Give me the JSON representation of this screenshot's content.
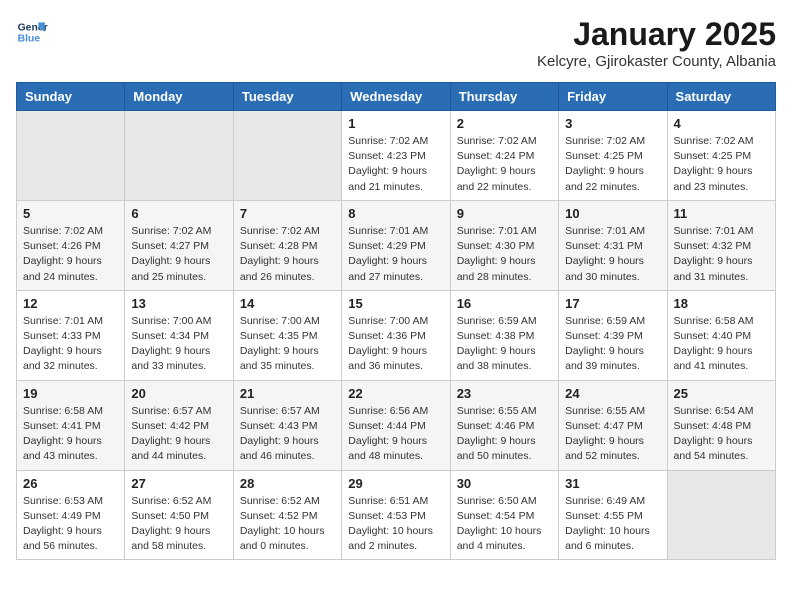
{
  "logo": {
    "line1": "General",
    "line2": "Blue"
  },
  "title": "January 2025",
  "subtitle": "Kelcyre, Gjirokaster County, Albania",
  "headers": [
    "Sunday",
    "Monday",
    "Tuesday",
    "Wednesday",
    "Thursday",
    "Friday",
    "Saturday"
  ],
  "weeks": [
    [
      {
        "day": "",
        "info": ""
      },
      {
        "day": "",
        "info": ""
      },
      {
        "day": "",
        "info": ""
      },
      {
        "day": "1",
        "info": "Sunrise: 7:02 AM\nSunset: 4:23 PM\nDaylight: 9 hours\nand 21 minutes."
      },
      {
        "day": "2",
        "info": "Sunrise: 7:02 AM\nSunset: 4:24 PM\nDaylight: 9 hours\nand 22 minutes."
      },
      {
        "day": "3",
        "info": "Sunrise: 7:02 AM\nSunset: 4:25 PM\nDaylight: 9 hours\nand 22 minutes."
      },
      {
        "day": "4",
        "info": "Sunrise: 7:02 AM\nSunset: 4:25 PM\nDaylight: 9 hours\nand 23 minutes."
      }
    ],
    [
      {
        "day": "5",
        "info": "Sunrise: 7:02 AM\nSunset: 4:26 PM\nDaylight: 9 hours\nand 24 minutes."
      },
      {
        "day": "6",
        "info": "Sunrise: 7:02 AM\nSunset: 4:27 PM\nDaylight: 9 hours\nand 25 minutes."
      },
      {
        "day": "7",
        "info": "Sunrise: 7:02 AM\nSunset: 4:28 PM\nDaylight: 9 hours\nand 26 minutes."
      },
      {
        "day": "8",
        "info": "Sunrise: 7:01 AM\nSunset: 4:29 PM\nDaylight: 9 hours\nand 27 minutes."
      },
      {
        "day": "9",
        "info": "Sunrise: 7:01 AM\nSunset: 4:30 PM\nDaylight: 9 hours\nand 28 minutes."
      },
      {
        "day": "10",
        "info": "Sunrise: 7:01 AM\nSunset: 4:31 PM\nDaylight: 9 hours\nand 30 minutes."
      },
      {
        "day": "11",
        "info": "Sunrise: 7:01 AM\nSunset: 4:32 PM\nDaylight: 9 hours\nand 31 minutes."
      }
    ],
    [
      {
        "day": "12",
        "info": "Sunrise: 7:01 AM\nSunset: 4:33 PM\nDaylight: 9 hours\nand 32 minutes."
      },
      {
        "day": "13",
        "info": "Sunrise: 7:00 AM\nSunset: 4:34 PM\nDaylight: 9 hours\nand 33 minutes."
      },
      {
        "day": "14",
        "info": "Sunrise: 7:00 AM\nSunset: 4:35 PM\nDaylight: 9 hours\nand 35 minutes."
      },
      {
        "day": "15",
        "info": "Sunrise: 7:00 AM\nSunset: 4:36 PM\nDaylight: 9 hours\nand 36 minutes."
      },
      {
        "day": "16",
        "info": "Sunrise: 6:59 AM\nSunset: 4:38 PM\nDaylight: 9 hours\nand 38 minutes."
      },
      {
        "day": "17",
        "info": "Sunrise: 6:59 AM\nSunset: 4:39 PM\nDaylight: 9 hours\nand 39 minutes."
      },
      {
        "day": "18",
        "info": "Sunrise: 6:58 AM\nSunset: 4:40 PM\nDaylight: 9 hours\nand 41 minutes."
      }
    ],
    [
      {
        "day": "19",
        "info": "Sunrise: 6:58 AM\nSunset: 4:41 PM\nDaylight: 9 hours\nand 43 minutes."
      },
      {
        "day": "20",
        "info": "Sunrise: 6:57 AM\nSunset: 4:42 PM\nDaylight: 9 hours\nand 44 minutes."
      },
      {
        "day": "21",
        "info": "Sunrise: 6:57 AM\nSunset: 4:43 PM\nDaylight: 9 hours\nand 46 minutes."
      },
      {
        "day": "22",
        "info": "Sunrise: 6:56 AM\nSunset: 4:44 PM\nDaylight: 9 hours\nand 48 minutes."
      },
      {
        "day": "23",
        "info": "Sunrise: 6:55 AM\nSunset: 4:46 PM\nDaylight: 9 hours\nand 50 minutes."
      },
      {
        "day": "24",
        "info": "Sunrise: 6:55 AM\nSunset: 4:47 PM\nDaylight: 9 hours\nand 52 minutes."
      },
      {
        "day": "25",
        "info": "Sunrise: 6:54 AM\nSunset: 4:48 PM\nDaylight: 9 hours\nand 54 minutes."
      }
    ],
    [
      {
        "day": "26",
        "info": "Sunrise: 6:53 AM\nSunset: 4:49 PM\nDaylight: 9 hours\nand 56 minutes."
      },
      {
        "day": "27",
        "info": "Sunrise: 6:52 AM\nSunset: 4:50 PM\nDaylight: 9 hours\nand 58 minutes."
      },
      {
        "day": "28",
        "info": "Sunrise: 6:52 AM\nSunset: 4:52 PM\nDaylight: 10 hours\nand 0 minutes."
      },
      {
        "day": "29",
        "info": "Sunrise: 6:51 AM\nSunset: 4:53 PM\nDaylight: 10 hours\nand 2 minutes."
      },
      {
        "day": "30",
        "info": "Sunrise: 6:50 AM\nSunset: 4:54 PM\nDaylight: 10 hours\nand 4 minutes."
      },
      {
        "day": "31",
        "info": "Sunrise: 6:49 AM\nSunset: 4:55 PM\nDaylight: 10 hours\nand 6 minutes."
      },
      {
        "day": "",
        "info": ""
      }
    ]
  ]
}
